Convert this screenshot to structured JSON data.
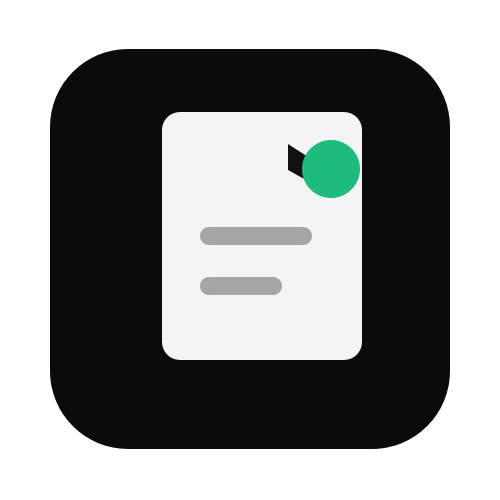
{
  "colors": {
    "page_background": "#ffffff",
    "icon_background": "#0b0b0c",
    "document": "#f4f4f6",
    "document_fold": "#111111",
    "text_lines": "#a6a6a8",
    "status_badge": "#1fbb7d"
  },
  "icon": {
    "name": "document-icon",
    "badge": "status-dot-icon",
    "lines": [
      "text-line-icon",
      "text-line-icon"
    ]
  }
}
